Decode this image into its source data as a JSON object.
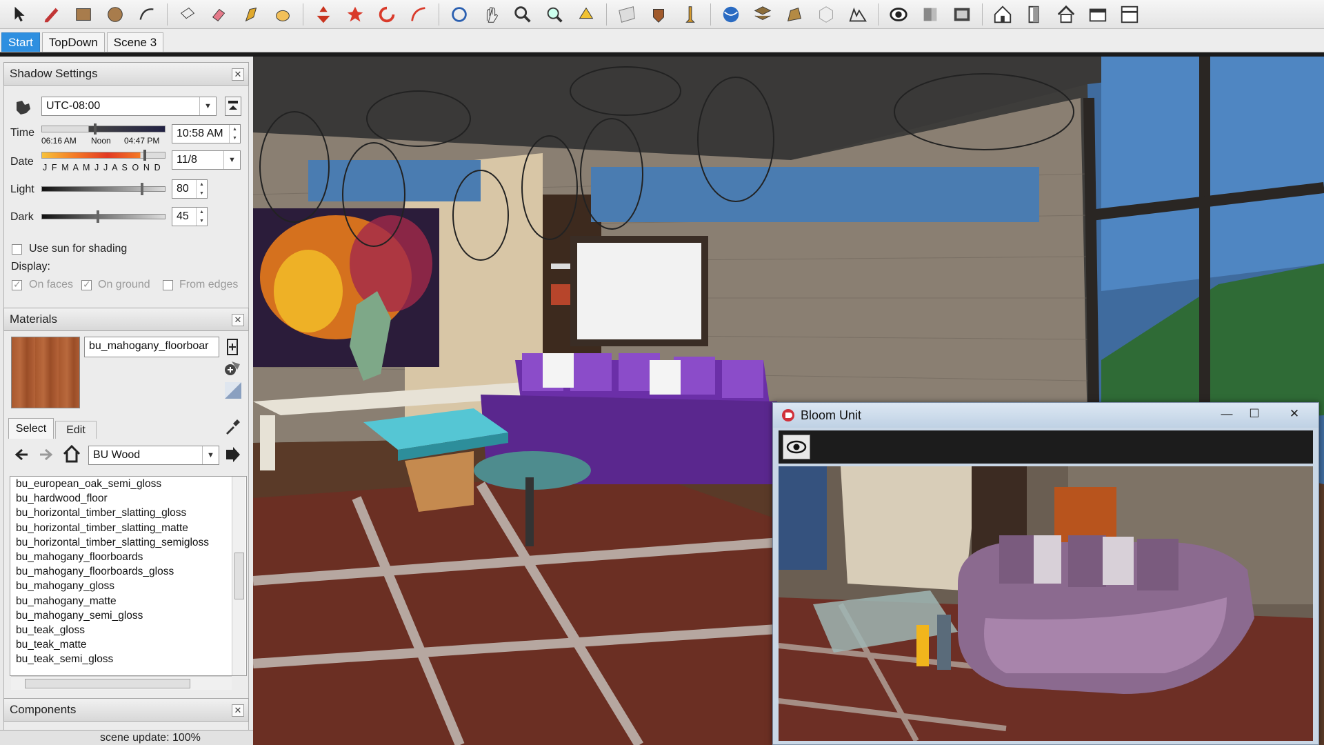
{
  "toolbar": {
    "tools": [
      "select-icon",
      "pencil-icon",
      "rectangle-icon",
      "circle-icon",
      "arc-icon",
      "eraser-icon",
      "paint-bucket-icon",
      "tape-measure-icon",
      "push-pull-icon",
      "move-icon",
      "rotate-icon",
      "follow-me-icon",
      "orbit-icon",
      "pan-icon",
      "zoom-icon",
      "zoom-extents-icon",
      "section-icon",
      "position-camera-icon",
      "walk-icon",
      "look-around-icon",
      "geo-icon",
      "import-icon",
      "export-icon",
      "layer-icon",
      "warehouse-icon",
      "sandbox-icon",
      "eye-icon",
      "light-icon",
      "render-icon",
      "house-icon",
      "door-icon",
      "roof-icon",
      "wall-icon",
      "window-icon"
    ]
  },
  "scenes": [
    {
      "label": "Start",
      "active": true
    },
    {
      "label": "TopDown",
      "active": false
    },
    {
      "label": "Scene 3",
      "active": false
    }
  ],
  "shadow": {
    "title": "Shadow Settings",
    "timezone": "UTC-08:00",
    "time_label": "Time",
    "sunrise": "06:16 AM",
    "noon": "Noon",
    "sunset": "04:47 PM",
    "time_value": "10:58 AM",
    "date_label": "Date",
    "months": "J F M A M J J A S O N D",
    "date_value": "11/8",
    "light_label": "Light",
    "light_value": "80",
    "dark_label": "Dark",
    "dark_value": "45",
    "use_sun": "Use sun for shading",
    "display_label": "Display:",
    "on_faces": "On faces",
    "on_ground": "On ground",
    "from_edges": "From edges"
  },
  "materials": {
    "title": "Materials",
    "current_name": "bu_mahogany_floorboar",
    "tab_select": "Select",
    "tab_edit": "Edit",
    "library": "BU Wood",
    "items": [
      "bu_european_oak_semi_gloss",
      "bu_hardwood_floor",
      "bu_horizontal_timber_slatting_gloss",
      "bu_horizontal_timber_slatting_matte",
      "bu_horizontal_timber_slatting_semigloss",
      "bu_mahogany_floorboards",
      "bu_mahogany_floorboards_gloss",
      "bu_mahogany_gloss",
      "bu_mahogany_matte",
      "bu_mahogany_semi_gloss",
      "bu_teak_gloss",
      "bu_teak_matte",
      "bu_teak_semi_gloss"
    ]
  },
  "components": {
    "title": "Components"
  },
  "status": {
    "text": "scene update: 100%"
  },
  "bloom": {
    "title": "Bloom Unit",
    "minimize": "—",
    "maximize": "☐",
    "close": "✕"
  },
  "colors": {
    "accent": "#2e8fe0",
    "sofa": "#6b2fa8",
    "glass": "#55c6d4",
    "brick": "#8a7f72"
  }
}
